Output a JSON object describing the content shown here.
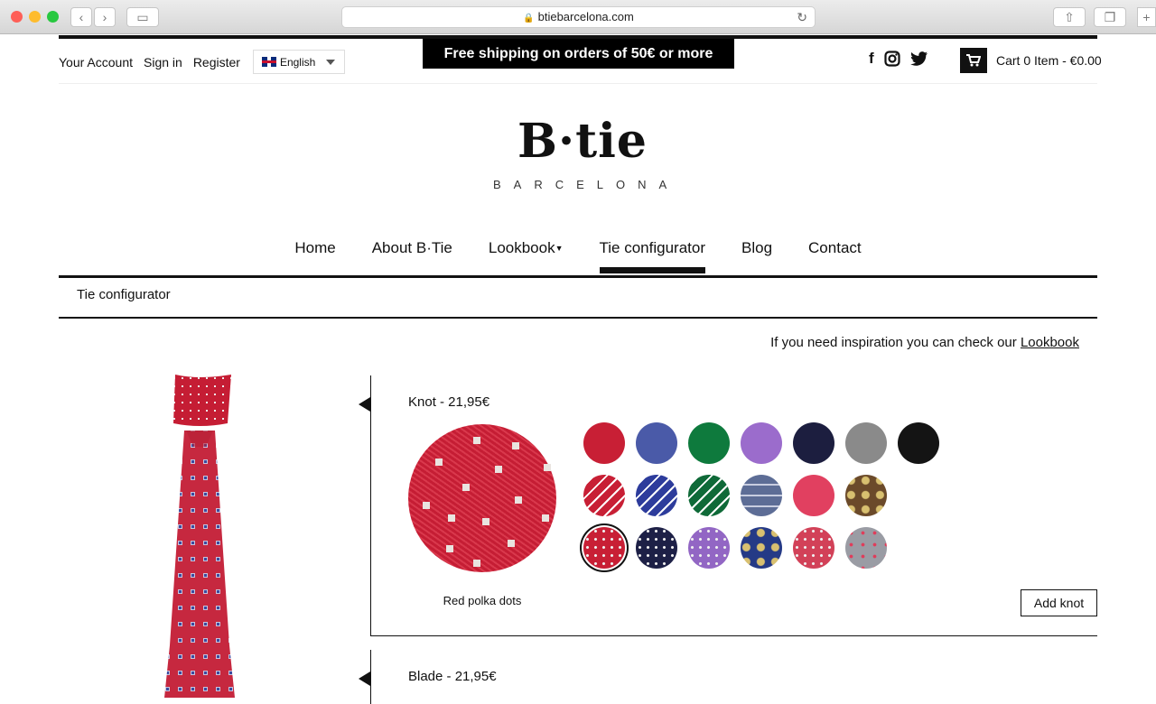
{
  "browser": {
    "url": "btiebarcelona.com"
  },
  "top": {
    "account": "Your Account",
    "signin": "Sign in",
    "register": "Register",
    "language": "English",
    "promo": "Free shipping on orders of 50€ or more",
    "cart": "Cart 0 Item - €0.00"
  },
  "logo": {
    "main": "B·tie",
    "sub": "BARCELONA"
  },
  "nav": [
    "Home",
    "About B·Tie",
    "Lookbook",
    "Tie configurator",
    "Blog",
    "Contact"
  ],
  "breadcrumb": "Tie configurator",
  "inspiration": {
    "text": "If you need inspiration you can check our ",
    "link": "Lookbook"
  },
  "knot": {
    "title": "Knot - 21,95€",
    "selected_name": "Red polka dots",
    "add_label": "Add knot",
    "swatches": [
      {
        "color": "#c81f35"
      },
      {
        "color": "#4a5aa8"
      },
      {
        "color": "#0e7a3d"
      },
      {
        "color": "#9b6ccc"
      },
      {
        "color": "#1c1e3f"
      },
      {
        "color": "#8a8a8a"
      },
      {
        "color": "#141414"
      },
      {
        "color": "#c81f35",
        "pattern": "stripes-white"
      },
      {
        "color": "#2d3c9c",
        "pattern": "stripes-white"
      },
      {
        "color": "#0f6a38",
        "pattern": "stripes-white"
      },
      {
        "color": "#5d6d96",
        "pattern": "check"
      },
      {
        "color": "#e14060"
      },
      {
        "color": "#6b4a2a",
        "pattern": "paisley"
      },
      {
        "color": "#c81f35",
        "pattern": "dots",
        "selected": true
      },
      {
        "color": "#1d2046",
        "pattern": "dots"
      },
      {
        "color": "#9266c4",
        "pattern": "dots"
      },
      {
        "color": "#253a86",
        "pattern": "paisley"
      },
      {
        "color": "#d24158",
        "pattern": "dots"
      },
      {
        "color": "#9a9ca4",
        "pattern": "motif"
      }
    ]
  },
  "blade": {
    "title": "Blade - 21,95€"
  }
}
